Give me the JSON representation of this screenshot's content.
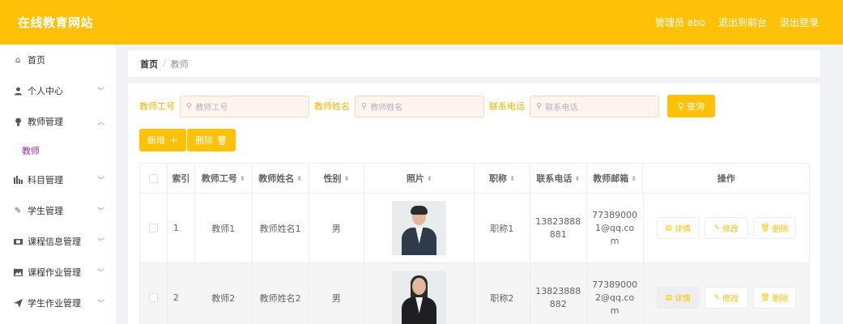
{
  "header": {
    "brand": "在线教育网站",
    "admin": "管理员 abo",
    "back_front": "退出到前台",
    "logout": "退出登录"
  },
  "sidebar": {
    "items": [
      {
        "label": "首页",
        "icon": "home-icon",
        "chevron": ""
      },
      {
        "label": "个人中心",
        "icon": "user-icon",
        "chevron": "﹀"
      },
      {
        "label": "教师管理",
        "icon": "bulb-icon",
        "chevron": "︿"
      },
      {
        "label": "科目管理",
        "icon": "chart-icon",
        "chevron": "﹀"
      },
      {
        "label": "学生管理",
        "icon": "pencil-icon",
        "chevron": "﹀"
      },
      {
        "label": "课程信息管理",
        "icon": "film-icon",
        "chevron": "﹀"
      },
      {
        "label": "课程作业管理",
        "icon": "image-icon",
        "chevron": "﹀"
      },
      {
        "label": "学生作业管理",
        "icon": "send-icon",
        "chevron": "﹀"
      }
    ],
    "sub_item": "教师"
  },
  "breadcrumb": {
    "home": "首页",
    "sep": "/",
    "current": "教师"
  },
  "search": {
    "f1_label": "教师工号",
    "f1_placeholder": "教师工号",
    "f2_label": "教师姓名",
    "f2_placeholder": "教师姓名",
    "f3_label": "联系电话",
    "f3_placeholder": "联系电话",
    "query": "查询"
  },
  "actions": {
    "add": "新增",
    "delete": "删除"
  },
  "table": {
    "headers": [
      "索引",
      "教师工号",
      "教师姓名",
      "性别",
      "照片",
      "职称",
      "联系电话",
      "教师邮箱",
      "操作"
    ],
    "rows": [
      {
        "index": "1",
        "no": "教师1",
        "name": "教师姓名1",
        "gender": "男",
        "title": "职称1",
        "phone": "13823888881",
        "email": "773890001@qq.com"
      },
      {
        "index": "2",
        "no": "教师2",
        "name": "教师姓名2",
        "gender": "男",
        "title": "职称2",
        "phone": "13823888882",
        "email": "773890002@qq.com"
      }
    ],
    "ops": {
      "detail": "详情",
      "edit": "修改",
      "delete": "删除"
    }
  },
  "colors": {
    "accent": "#ffc107",
    "sub_active": "#9c27b0"
  }
}
